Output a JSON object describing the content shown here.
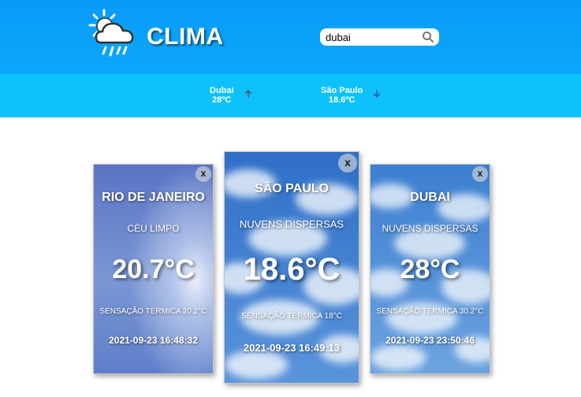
{
  "header": {
    "logo_text": "CLIMA",
    "search_value": "dubai",
    "search_placeholder": ""
  },
  "ticker": [
    {
      "city": "Dubai",
      "temp": "28ºC",
      "trend": "up",
      "trend_color": "#4a5b7a"
    },
    {
      "city": "São Paulo",
      "temp": "18.6ºC",
      "trend": "down",
      "trend_color": "#1f5fae"
    }
  ],
  "cards": [
    {
      "city": "RIO DE JANEIRO",
      "description": "CÉU LIMPO",
      "temperature": "20.7°C",
      "feels_like": "SENSAÇÃO TERMICA 20.2°C",
      "datetime": "2021-09-23 16:48:32",
      "close": "x"
    },
    {
      "city": "SÃO PAULO",
      "description": "NUVENS DISPERSAS",
      "temperature": "18.6°C",
      "feels_like": "SENSAÇÃO TERMICA 18°C",
      "datetime": "2021-09-23 16:49:13",
      "close": "x"
    },
    {
      "city": "DUBAI",
      "description": "NUVENS DISPERSAS",
      "temperature": "28°C",
      "feels_like": "SENSAÇÃO TERMICA 30.2°C",
      "datetime": "2021-09-23 23:50:46",
      "close": "x"
    }
  ],
  "colors": {
    "header": "#0a9af7",
    "ticker": "#0fc1fb",
    "clear_sky": "#5f86cf",
    "cloudy_sky": "#3f7fcf"
  }
}
